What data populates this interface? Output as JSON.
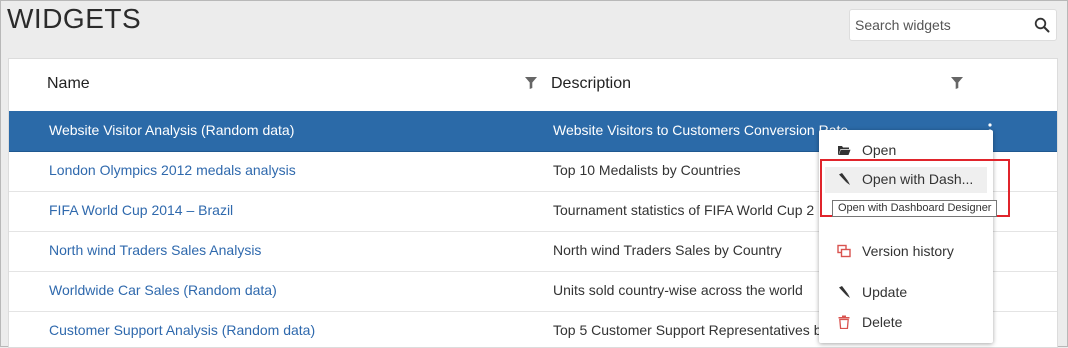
{
  "page": {
    "title": "WIDGETS"
  },
  "search": {
    "placeholder": "Search widgets",
    "icon": "search-icon"
  },
  "grid": {
    "columns": [
      {
        "label": "Name",
        "filter_icon": "filter-icon"
      },
      {
        "label": "Description",
        "filter_icon": "filter-icon"
      }
    ],
    "rows": [
      {
        "name": "Website Visitor Analysis (Random data)",
        "description": "Website Visitors to Customers Conversion Rate",
        "selected": true
      },
      {
        "name": "London Olympics 2012 medals analysis",
        "description": "Top 10 Medalists by Countries"
      },
      {
        "name": "FIFA World Cup 2014 – Brazil",
        "description": "Tournament statistics of FIFA World Cup 2"
      },
      {
        "name": "North wind Traders Sales Analysis",
        "description": "North wind Traders Sales by Country"
      },
      {
        "name": "Worldwide Car Sales (Random data)",
        "description": "Units sold country-wise across the world"
      },
      {
        "name": "Customer Support Analysis (Random data)",
        "description": "Top 5 Customer Support Representatives b"
      }
    ]
  },
  "context_menu": {
    "items": [
      {
        "label": "Open",
        "icon": "folder-open-icon"
      },
      {
        "label": "Open with Dash...",
        "icon": "pen-icon"
      },
      {
        "label": "Version history",
        "icon": "version-history-icon"
      },
      {
        "label": "Update",
        "icon": "pen-icon"
      },
      {
        "label": "Delete",
        "icon": "trash-icon"
      }
    ]
  },
  "tooltip": {
    "text": "Open with Dashboard Designer"
  },
  "colors": {
    "selected_row": "#2b6aa8",
    "link": "#2f69ad",
    "highlight_border": "#e0242b",
    "delete_icon": "#d9534f",
    "version_icon": "#d9534f"
  }
}
